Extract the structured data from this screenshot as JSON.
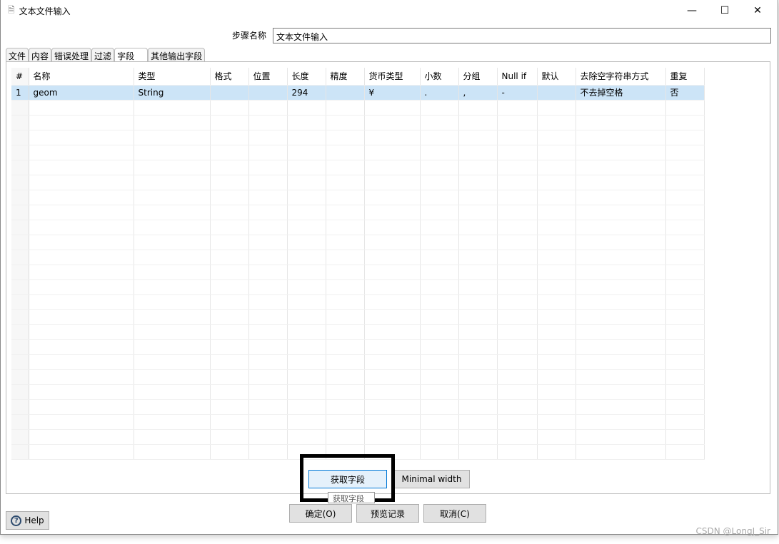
{
  "window": {
    "title": "文本文件输入",
    "minimize": "—",
    "maximize": "☐",
    "close": "✕"
  },
  "step": {
    "label": "步骤名称",
    "value": "文本文件输入"
  },
  "tabs": [
    "文件",
    "内容",
    "错误处理",
    "过滤",
    "字段",
    "其他输出字段"
  ],
  "table": {
    "columns": [
      "#",
      "名称",
      "类型",
      "格式",
      "位置",
      "长度",
      "精度",
      "货币类型",
      "小数",
      "分组",
      "Null if",
      "默认",
      "去除空字符串方式",
      "重复"
    ],
    "rows": [
      [
        "1",
        "geom",
        "String",
        "",
        "",
        "294",
        "",
        "¥",
        ".",
        ",",
        "-",
        "",
        "不去掉空格",
        "否"
      ]
    ]
  },
  "buttons": {
    "get_fields": "获取字段",
    "minimal_width": "Minimal width",
    "ok": "确定(O)",
    "preview": "预览记录",
    "cancel": "取消(C)",
    "help": "Help"
  },
  "tooltip": "获取字段",
  "watermark": "CSDN @LongJ_Sir"
}
